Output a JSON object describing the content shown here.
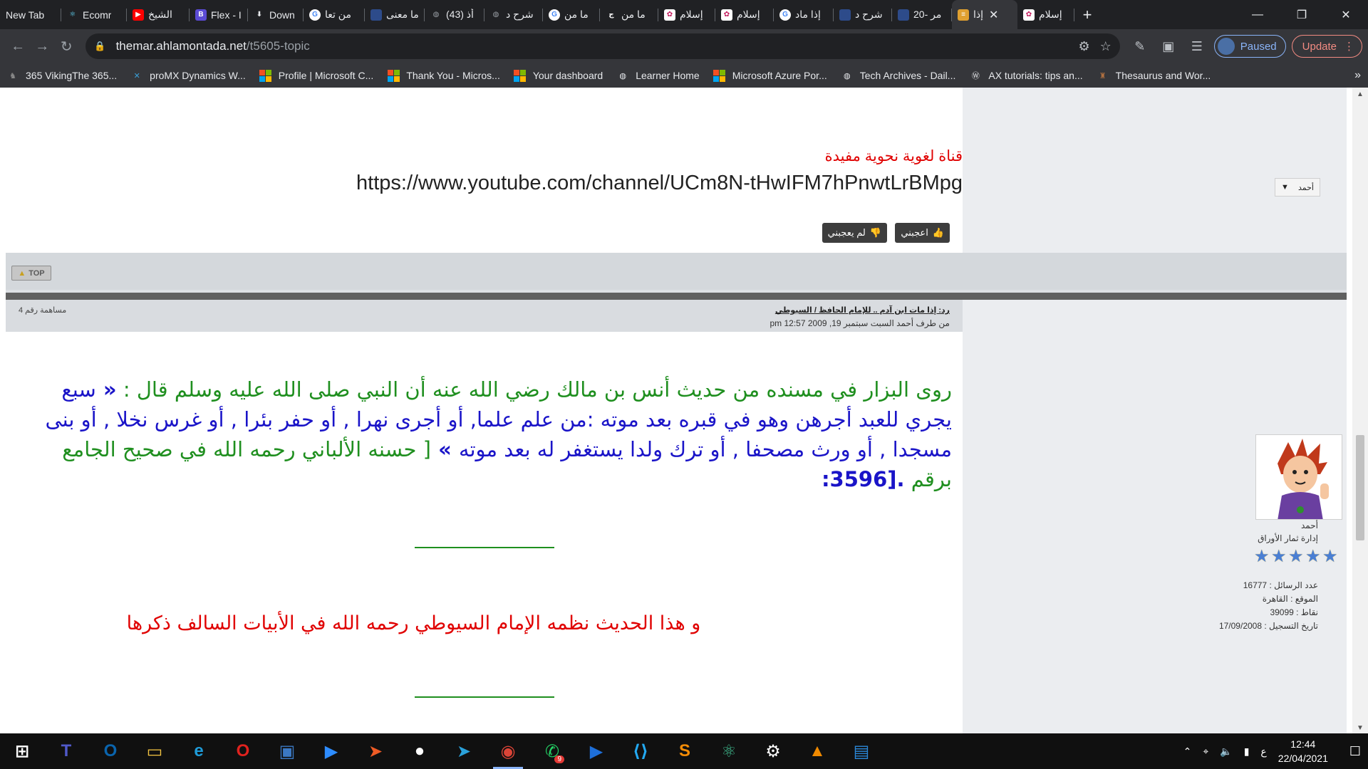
{
  "browser": {
    "tabs": [
      {
        "title": "New Tab",
        "icon": "none",
        "color": "#202124"
      },
      {
        "title": "Ecomr",
        "icon": "react-icon",
        "color": "#61dafb"
      },
      {
        "title": "الشيخ",
        "icon": "youtube-icon",
        "color": "#ff0000"
      },
      {
        "title": "Flex - I",
        "icon": "b-icon",
        "color": "#5b4bd5"
      },
      {
        "title": "Down",
        "icon": "download-icon",
        "color": "#e8eaed"
      },
      {
        "title": "من تعا",
        "icon": "google-icon",
        "color": "#ffffff"
      },
      {
        "title": "ما معنى",
        "icon": "forum-icon",
        "color": "#2d4b8a"
      },
      {
        "title": "(43) أذ",
        "icon": "globe-icon",
        "color": "#9aa0a6"
      },
      {
        "title": "شرح د",
        "icon": "globe-icon",
        "color": "#9aa0a6"
      },
      {
        "title": "ما من",
        "icon": "google-icon",
        "color": "#ffffff"
      },
      {
        "title": "ما من",
        "icon": "arabic-site-icon",
        "color": "#ffffff"
      },
      {
        "title": "إسلام",
        "icon": "islam-site-icon",
        "color": "#c2185b"
      },
      {
        "title": "إسلام",
        "icon": "islam-site-icon",
        "color": "#c2185b"
      },
      {
        "title": "إذا ماد",
        "icon": "google-icon",
        "color": "#ffffff"
      },
      {
        "title": "شرح د",
        "icon": "forum-icon",
        "color": "#2d4b8a"
      },
      {
        "title": "20- مر",
        "icon": "forum-icon",
        "color": "#2d4b8a"
      },
      {
        "title": "إذا",
        "icon": "book-stack-icon",
        "color": "#e0a030",
        "active": true
      },
      {
        "title": "إسلام",
        "icon": "islam-site-icon",
        "color": "#c2185b"
      }
    ],
    "url_host": "themar.ahlamontada.net",
    "url_path": "/t5605-topic",
    "profile_label": "Paused",
    "update_label": "Update",
    "bookmarks": [
      {
        "label": "365 VikingThe 365...",
        "icon": "viking-icon"
      },
      {
        "label": "proMX Dynamics W...",
        "icon": "promx-icon"
      },
      {
        "label": "Profile | Microsoft C...",
        "icon": "microsoft-icon"
      },
      {
        "label": "Thank You - Micros...",
        "icon": "microsoft-icon"
      },
      {
        "label": "Your dashboard",
        "icon": "microsoft-icon"
      },
      {
        "label": "Learner Home",
        "icon": "globe-icon"
      },
      {
        "label": "Microsoft Azure Por...",
        "icon": "microsoft-icon"
      },
      {
        "label": "Tech Archives - Dail...",
        "icon": "globe-icon"
      },
      {
        "label": "AX tutorials: tips an...",
        "icon": "wordpress-icon"
      },
      {
        "label": "Thesaurus and Wor...",
        "icon": "thesaurus-icon"
      }
    ],
    "bookmarks_more": "»"
  },
  "forum": {
    "post1": {
      "signature_title": "قناة لغوية نحوية مفيدة",
      "signature_link": "https://www.youtube.com/channel/UCm8N-tHwIFM7hPnwtLrBMpg",
      "like_label": "اعجبني",
      "dislike_label": "لم يعجبني"
    },
    "top_label": "TOP",
    "post2": {
      "number_label": "مساهمة رقم 4",
      "title": "رد: إذا مات ابن آدم .. للإمام الحافظ / السيوطي",
      "meta": "من طرف أحمد السبت سبتمبر 19, 2009 12:57 pm",
      "hadith": {
        "part1": "روى البزار في مسنده من حديث أنس بن مالك رضي الله عنه أن النبي صلى الله عليه وسلم قال : ",
        "open_quote": "« ",
        "part2": "سبع يجري للعبد أجرهن وهو في قبره بعد موته :من علم علما, أو أجرى نهرا , أو حفر بئرا , أو غرس نخلا , أو بنى مسجدا , أو ورث مصحفا , أو ترك ولدا يستغفر له بعد موته",
        "close_quote": " » ",
        "part3": "[ حسنه الألباني رحمه الله في صحيح الجامع برقم ",
        "ref": ":3596]."
      },
      "suyuti_line": "و هذا الحديث نظمه الإمام السيوطي رحمه الله في الأبيات السالف ذكرها"
    },
    "user": {
      "menu_name": "أحمد",
      "display_name": "أحمد",
      "rank": "إدارة ثمار الأوراق",
      "stars": 5,
      "messages_label": "عدد الرسائل : 16777",
      "location_label": "الموقع : القاهرة",
      "points_label": "نقاط : 39099",
      "registered_label": "تاريخ التسجيل : 17/09/2008"
    }
  },
  "taskbar": {
    "apps": [
      {
        "name": "start-button",
        "icon": "windows-icon",
        "color": "#ffffff",
        "glyph": "⊞"
      },
      {
        "name": "teams-app",
        "icon": "teams-icon",
        "color": "#5059c9",
        "glyph": "T"
      },
      {
        "name": "outlook-app",
        "icon": "outlook-icon",
        "color": "#0a64ad",
        "glyph": "O"
      },
      {
        "name": "explorer-app",
        "icon": "folder-icon",
        "color": "#f4c542",
        "glyph": "▭"
      },
      {
        "name": "edge-app",
        "icon": "edge-icon",
        "color": "#1f9bd8",
        "glyph": "e"
      },
      {
        "name": "opera-app",
        "icon": "opera-icon",
        "color": "#e0221e",
        "glyph": "O"
      },
      {
        "name": "rdp-app",
        "icon": "remote-desktop-icon",
        "color": "#3b78c2",
        "glyph": "▣"
      },
      {
        "name": "zoom-app",
        "icon": "zoom-icon",
        "color": "#2d8cff",
        "glyph": "▶"
      },
      {
        "name": "postman-app",
        "icon": "postman-icon",
        "color": "#ef5b25",
        "glyph": "➤"
      },
      {
        "name": "kobo-app",
        "icon": "droplet-icon",
        "color": "#ffffff",
        "glyph": "●"
      },
      {
        "name": "telegram-app",
        "icon": "telegram-icon",
        "color": "#2aa1da",
        "glyph": "➤"
      },
      {
        "name": "chrome-app",
        "icon": "chrome-icon",
        "color": "#db4437",
        "glyph": "◉",
        "running": true
      },
      {
        "name": "whatsapp-app",
        "icon": "whatsapp-icon",
        "color": "#25d366",
        "glyph": "✆",
        "badge": "9"
      },
      {
        "name": "media-app",
        "icon": "media-icon",
        "color": "#1e6fd9",
        "glyph": "▶"
      },
      {
        "name": "vscode-app",
        "icon": "vscode-icon",
        "color": "#23a9f2",
        "glyph": "⟨⟩"
      },
      {
        "name": "sublime-app",
        "icon": "sublime-icon",
        "color": "#f48c06",
        "glyph": "S"
      },
      {
        "name": "atom-app",
        "icon": "atom-icon",
        "color": "#3fb68b",
        "glyph": "⚛"
      },
      {
        "name": "settings-app",
        "icon": "gear-icon",
        "color": "#ffffff",
        "glyph": "⚙"
      },
      {
        "name": "vlc-app",
        "icon": "vlc-icon",
        "color": "#f08a00",
        "glyph": "▲"
      },
      {
        "name": "photos-app",
        "icon": "photos-icon",
        "color": "#2b88d8",
        "glyph": "▤"
      }
    ],
    "ime": "ع",
    "time": "12:44",
    "date": "22/04/2021"
  }
}
